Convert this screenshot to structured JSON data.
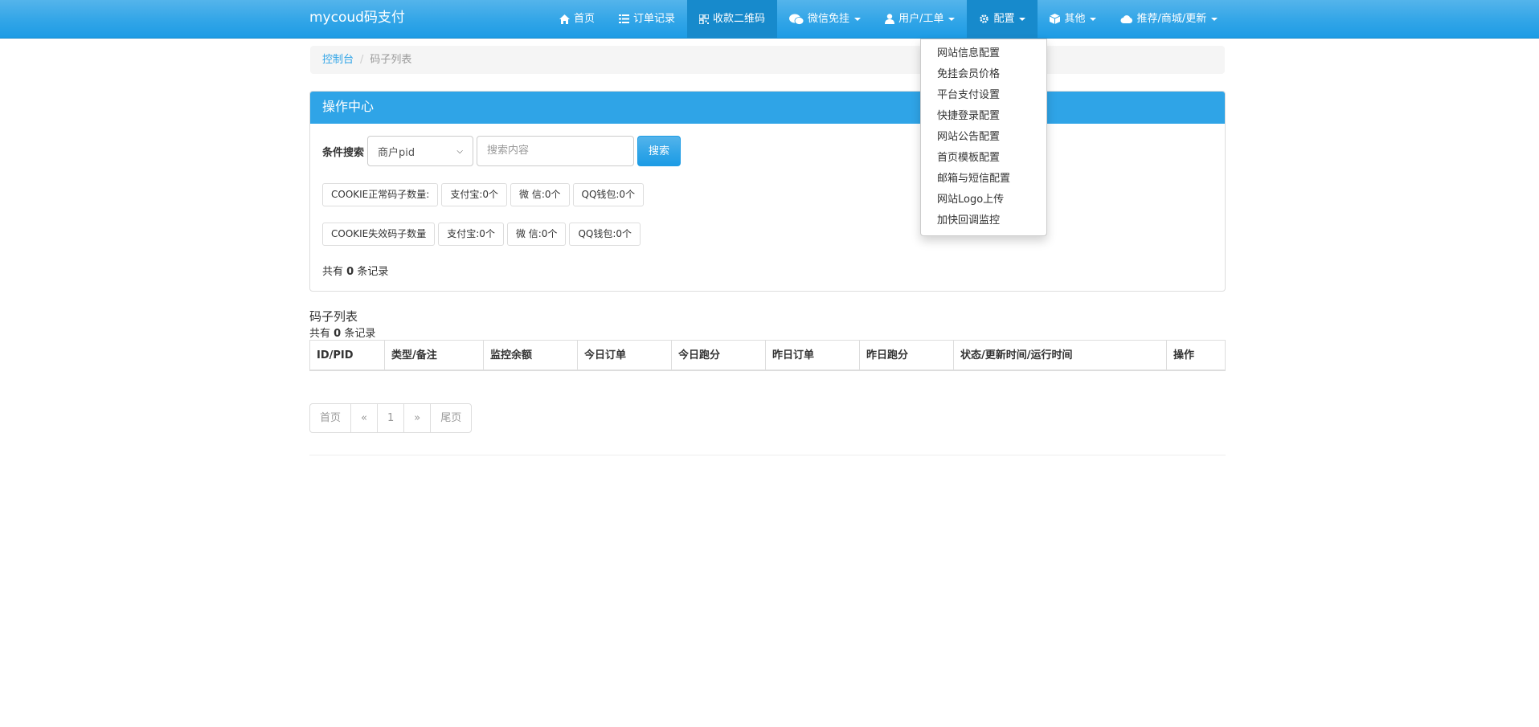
{
  "brand": "mycoud码支付",
  "nav": [
    {
      "label": "首页",
      "icon": "home-icon"
    },
    {
      "label": "订单记录",
      "icon": "list-icon"
    },
    {
      "label": "收款二维码",
      "icon": "qrcode-icon"
    },
    {
      "label": "微信免挂",
      "icon": "wechat-icon"
    },
    {
      "label": "用户/工单",
      "icon": "user-icon"
    },
    {
      "label": "配置",
      "icon": "gear-icon"
    },
    {
      "label": "其他",
      "icon": "cube-icon"
    },
    {
      "label": "推荐/商城/更新",
      "icon": "cloud-icon"
    }
  ],
  "dropdown": [
    "网站信息配置",
    "免挂会员价格",
    "平台支付设置",
    "快捷登录配置",
    "网站公告配置",
    "首页模板配置",
    "邮箱与短信配置",
    "网站Logo上传",
    "加快回调监控"
  ],
  "breadcrumb": {
    "home": "控制台",
    "current": "码子列表"
  },
  "panel": {
    "title": "操作中心",
    "search_label": "条件搜索",
    "select_value": "商户pid",
    "input_placeholder": "搜索内容",
    "search_button": "搜索",
    "row1": [
      "COOKIE正常码子数量:",
      "支付宝:0个",
      "微 信:0个",
      "QQ钱包:0个"
    ],
    "row2": [
      "COOKIE失效码子数量",
      "支付宝:0个",
      "微 信:0个",
      "QQ钱包:0个"
    ],
    "count_prefix": "共有",
    "count": "0",
    "count_suffix": "条记录"
  },
  "list": {
    "title": "码子列表",
    "count_prefix": "共有",
    "count": "0",
    "count_suffix": "条记录",
    "columns": [
      "ID/PID",
      "类型/备注",
      "监控余额",
      "今日订单",
      "今日跑分",
      "昨日订单",
      "昨日跑分",
      "状态/更新时间/运行时间",
      "操作"
    ]
  },
  "pagination": [
    "首页",
    "«",
    "1",
    "»",
    "尾页"
  ],
  "colors": {
    "primary": "#2fa4e7",
    "primary_dark": "#178acc"
  }
}
